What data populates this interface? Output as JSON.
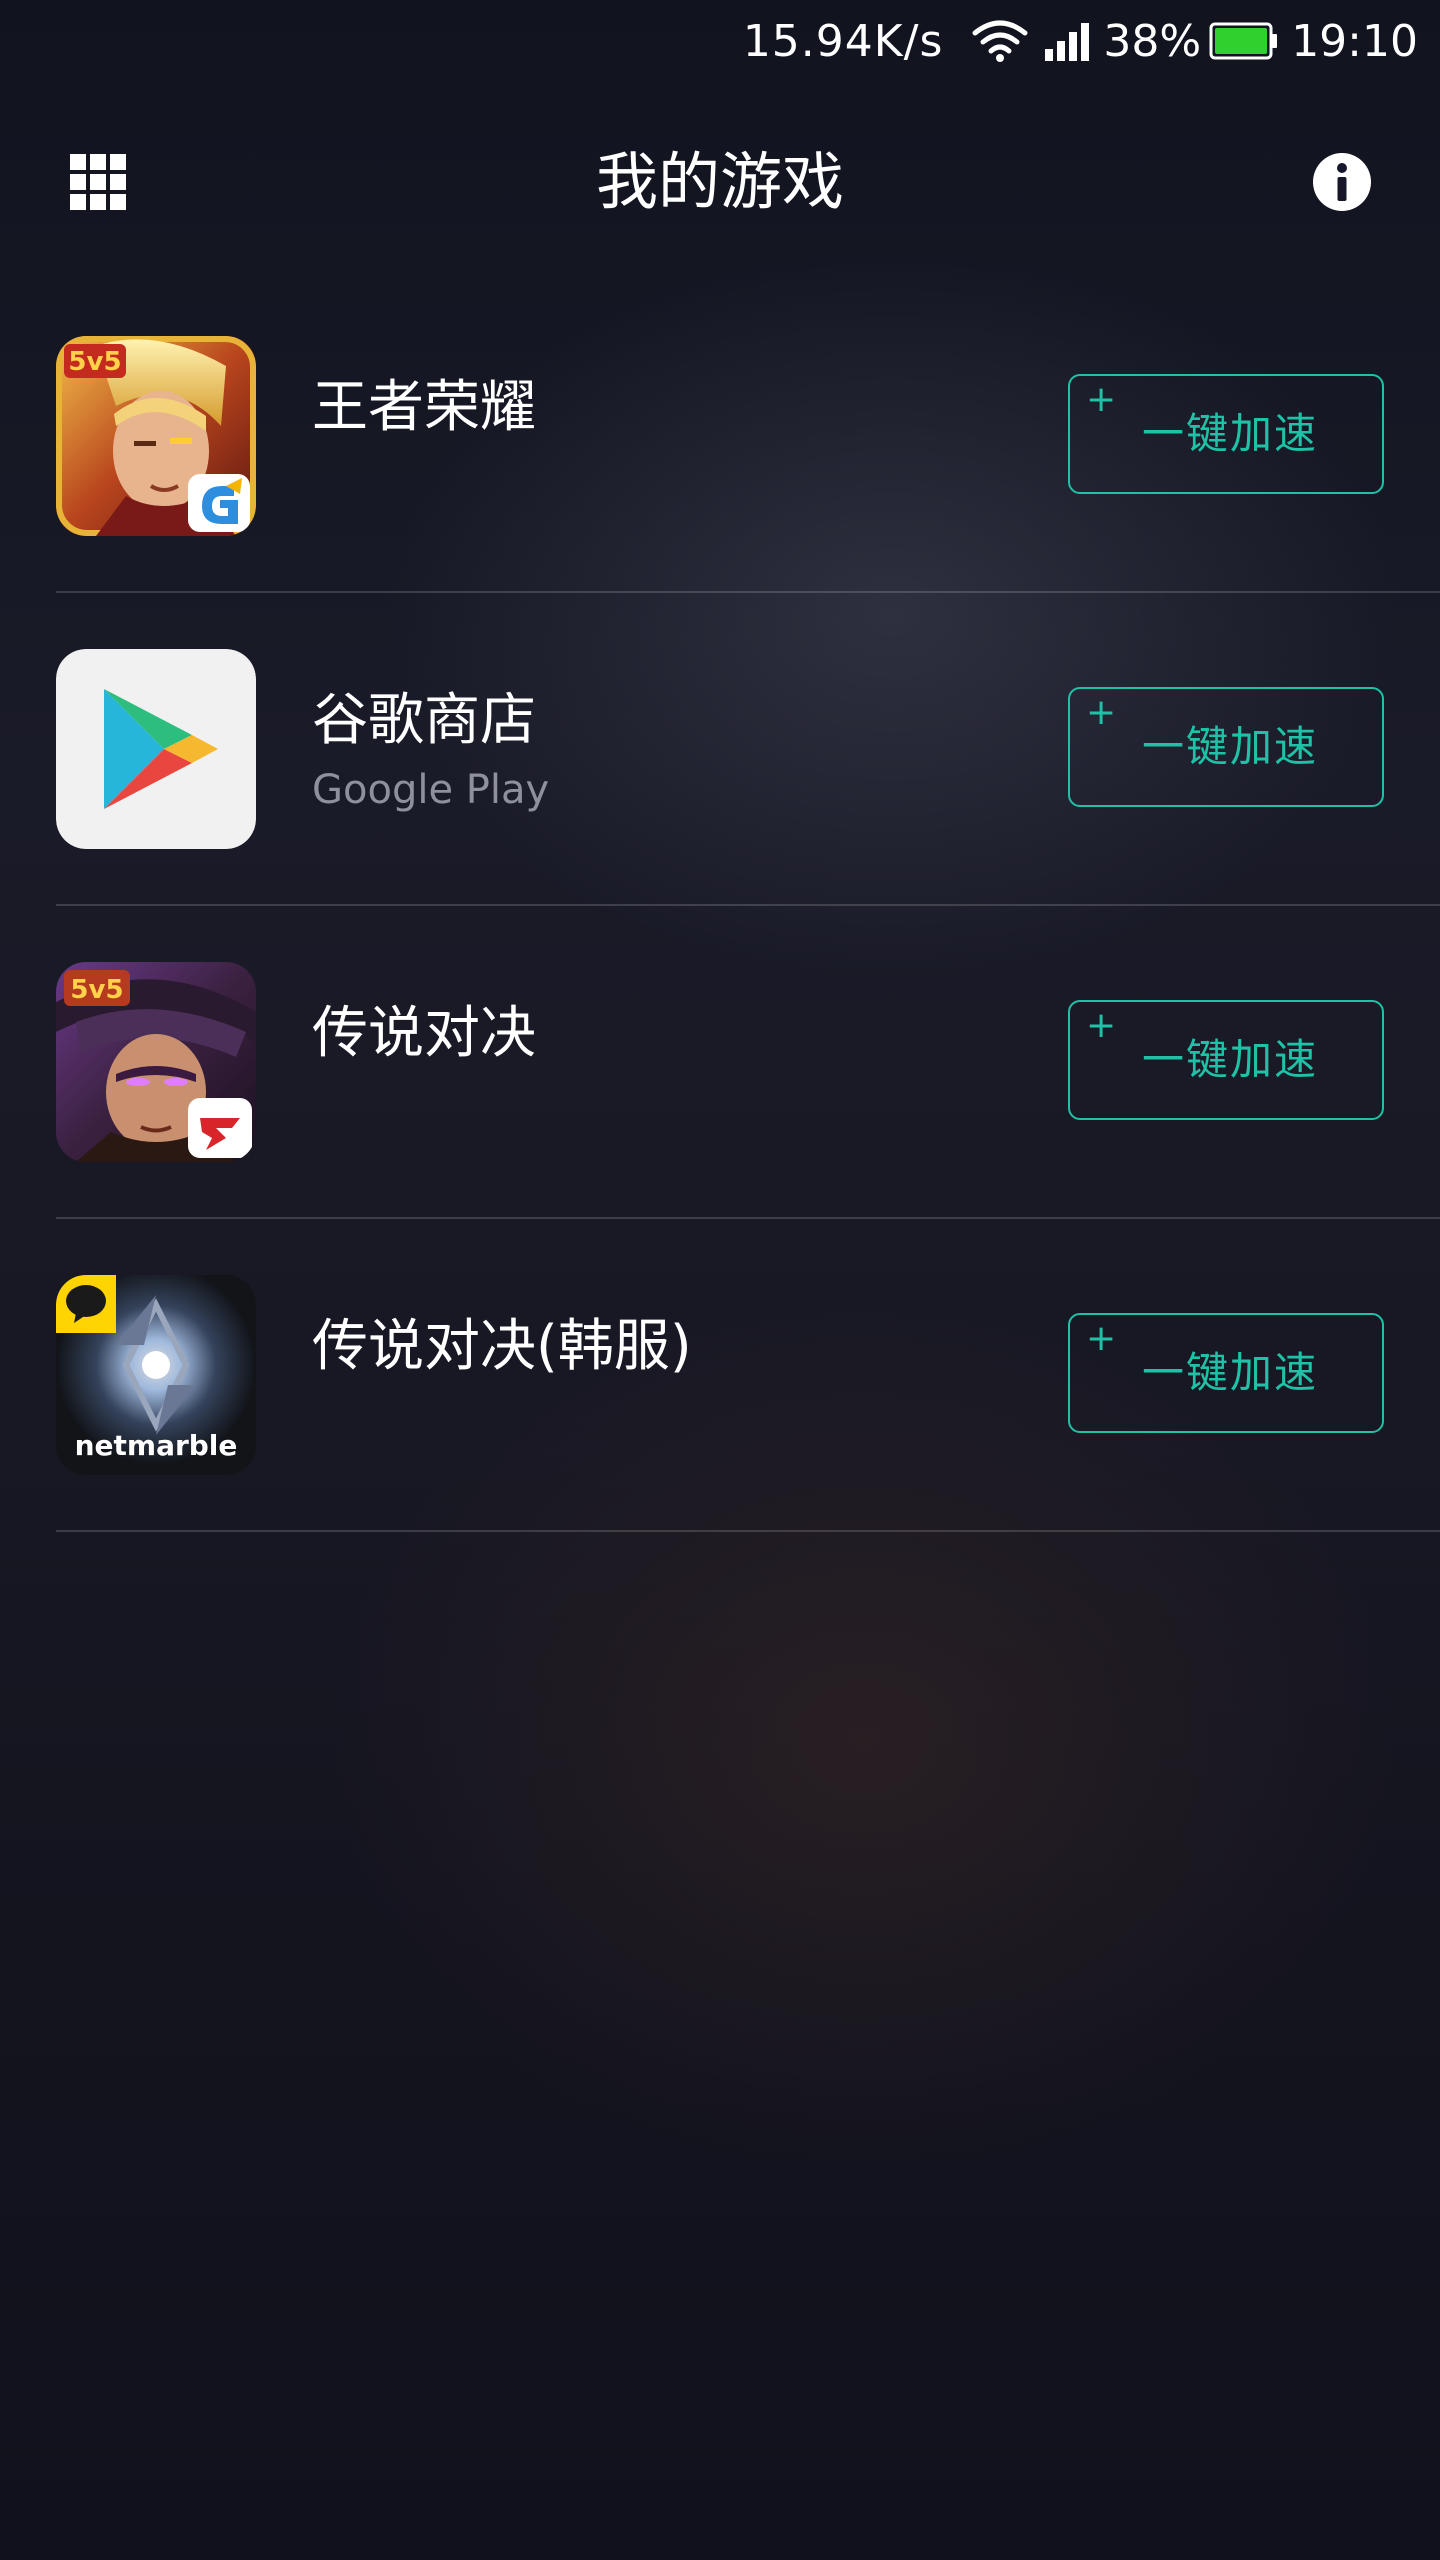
{
  "status_bar": {
    "net_speed": "15.94K/s",
    "battery_percent": "38%",
    "time": "19:10",
    "icons": [
      "wifi-icon",
      "signal-icon",
      "battery-icon"
    ]
  },
  "header": {
    "title": "我的游戏",
    "left_icon": "grid-menu-icon",
    "right_icon": "info-icon"
  },
  "games": [
    {
      "name": "王者荣耀",
      "subtitle": "",
      "button_label": "一键加速",
      "button_plus": "+",
      "icon": "honor-of-kings-icon"
    },
    {
      "name": "谷歌商店",
      "subtitle": "Google Play",
      "button_label": "一键加速",
      "button_plus": "+",
      "icon": "google-play-icon"
    },
    {
      "name": "传说对决",
      "subtitle": "",
      "button_label": "一键加速",
      "button_plus": "+",
      "icon": "arena-of-valor-icon"
    },
    {
      "name": "传说对决(韩服)",
      "subtitle": "",
      "button_label": "一键加速",
      "button_plus": "+",
      "icon": "netmarble-icon"
    }
  ],
  "icon_text": {
    "badge_5v5": "5v5",
    "netmarble": "netmarble"
  },
  "colors": {
    "accent": "#1fc2a6",
    "battery": "#2fd12f",
    "subtitle": "#8e909c"
  }
}
